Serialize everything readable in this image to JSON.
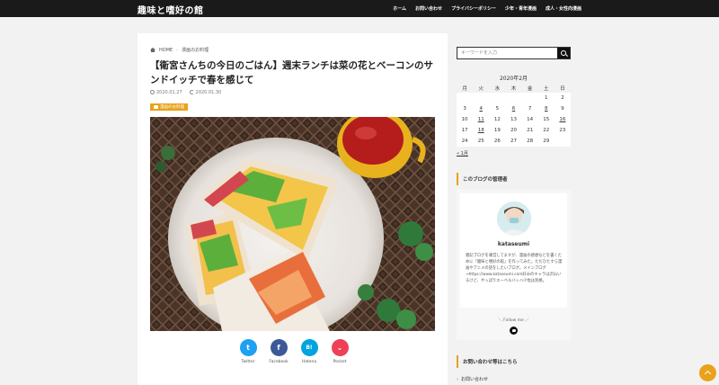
{
  "header": {
    "site_title": "趣味と嗜好の館",
    "nav": [
      "ホーム",
      "お問い合わせ",
      "プライバシーポリシー",
      "少年・青年漫画",
      "成人・女性向漫画"
    ]
  },
  "breadcrumb": {
    "home": "HOME",
    "category": "漫画のお料理"
  },
  "post": {
    "title": "【衛宮さんちの今日のごはん】週末ランチは菜の花とベーコンのサンドイッチで春を感じて",
    "published": "2020.01.27",
    "updated": "2020.01.30",
    "category": "漫画のお料理"
  },
  "share": [
    {
      "label": "Twitter",
      "icon": "twitter-icon",
      "glyph": "t",
      "color": "#1da1f2"
    },
    {
      "label": "Facebook",
      "icon": "facebook-icon",
      "glyph": "f",
      "color": "#3b5998"
    },
    {
      "label": "Hatena",
      "icon": "hatena-icon",
      "glyph": "B!",
      "color": "#00a4de"
    },
    {
      "label": "Pocket",
      "icon": "pocket-icon",
      "glyph": "⌄",
      "color": "#ee4056"
    }
  ],
  "sidebar": {
    "search_placeholder": "キーワードを入力",
    "calendar": {
      "caption": "2020年2月",
      "weekdays": [
        "月",
        "火",
        "水",
        "木",
        "金",
        "土",
        "日"
      ],
      "weeks": [
        [
          "",
          "",
          "",
          "",
          "",
          "1",
          "2"
        ],
        [
          "3",
          "4",
          "5",
          "6",
          "7",
          "8",
          "9"
        ],
        [
          "10",
          "11",
          "12",
          "13",
          "14",
          "15",
          "16"
        ],
        [
          "17",
          "18",
          "19",
          "20",
          "21",
          "22",
          "23"
        ],
        [
          "24",
          "25",
          "26",
          "27",
          "28",
          "29",
          ""
        ]
      ],
      "linked_days": [
        "4",
        "6",
        "8",
        "11",
        "16",
        "18"
      ],
      "prev": "« 1月"
    },
    "admin_heading": "このブログの管理者",
    "profile_name": "kataseumi",
    "profile_bio": "雑記ブログを運営してますが、漫画の感想などを書くために「趣味と嗜好の館」を作ってみた。ただひたすら漫画やアニメの話をしたいブログ。メインブログ→https://www.kataseumi.com好みのキャラは沢山いるけど、やっぱりエーベルバッハ少佐は別格。",
    "follow": "＼ Follow me ／",
    "contact_heading": "お問い合わせ等はこちら",
    "contact_link": "お問い合わせ"
  }
}
